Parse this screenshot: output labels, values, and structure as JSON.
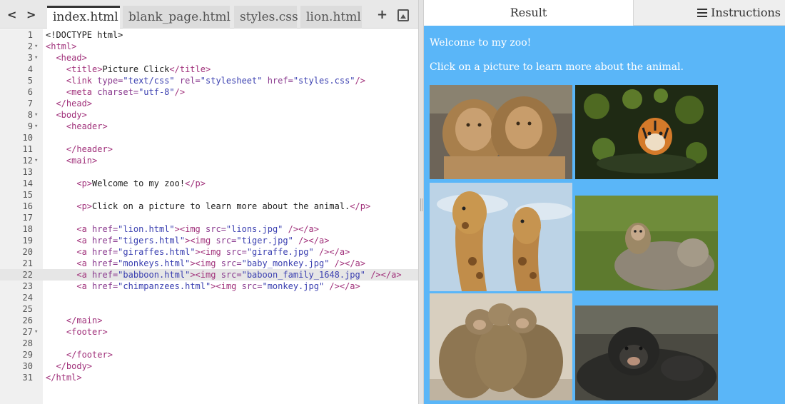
{
  "editor": {
    "tabs": [
      "index.html",
      "blank_page.html",
      "styles.css",
      "lion.html"
    ],
    "active_tab": 0,
    "nav_arrows": "< >",
    "add_tab_icon": "plus-icon",
    "image_tab_icon": "image-icon",
    "highlighted_line": 22,
    "lines": [
      {
        "n": "1",
        "fold": "",
        "tokens": [
          [
            "t",
            "<!DOCTYPE html>"
          ]
        ]
      },
      {
        "n": "2",
        "fold": "▾",
        "tokens": [
          [
            "g",
            "<html>"
          ]
        ]
      },
      {
        "n": "3",
        "fold": "▾",
        "tokens": [
          [
            "t",
            "  "
          ],
          [
            "g",
            "<head>"
          ]
        ]
      },
      {
        "n": "4",
        "fold": "",
        "tokens": [
          [
            "t",
            "    "
          ],
          [
            "g",
            "<title>"
          ],
          [
            "t",
            "Picture Click"
          ],
          [
            "g",
            "</title>"
          ]
        ]
      },
      {
        "n": "5",
        "fold": "",
        "tokens": [
          [
            "t",
            "    "
          ],
          [
            "g",
            "<link "
          ],
          [
            "a",
            "type="
          ],
          [
            "v",
            "\"text/css\""
          ],
          [
            "a",
            " rel="
          ],
          [
            "v",
            "\"stylesheet\""
          ],
          [
            "a",
            " href="
          ],
          [
            "v",
            "\"styles.css\""
          ],
          [
            "g",
            "/>"
          ]
        ]
      },
      {
        "n": "6",
        "fold": "",
        "tokens": [
          [
            "t",
            "    "
          ],
          [
            "g",
            "<meta "
          ],
          [
            "a",
            "charset="
          ],
          [
            "v",
            "\"utf-8\""
          ],
          [
            "g",
            "/>"
          ]
        ]
      },
      {
        "n": "7",
        "fold": "",
        "tokens": [
          [
            "t",
            "  "
          ],
          [
            "g",
            "</head>"
          ]
        ]
      },
      {
        "n": "8",
        "fold": "▾",
        "tokens": [
          [
            "t",
            "  "
          ],
          [
            "g",
            "<body>"
          ]
        ]
      },
      {
        "n": "9",
        "fold": "▾",
        "tokens": [
          [
            "t",
            "    "
          ],
          [
            "g",
            "<header>"
          ]
        ]
      },
      {
        "n": "10",
        "fold": "",
        "tokens": []
      },
      {
        "n": "11",
        "fold": "",
        "tokens": [
          [
            "t",
            "    "
          ],
          [
            "g",
            "</header>"
          ]
        ]
      },
      {
        "n": "12",
        "fold": "▾",
        "tokens": [
          [
            "t",
            "    "
          ],
          [
            "g",
            "<main>"
          ]
        ]
      },
      {
        "n": "13",
        "fold": "",
        "tokens": []
      },
      {
        "n": "14",
        "fold": "",
        "tokens": [
          [
            "t",
            "      "
          ],
          [
            "g",
            "<p>"
          ],
          [
            "t",
            "Welcome to my zoo!"
          ],
          [
            "g",
            "</p>"
          ]
        ]
      },
      {
        "n": "15",
        "fold": "",
        "tokens": []
      },
      {
        "n": "16",
        "fold": "",
        "tokens": [
          [
            "t",
            "      "
          ],
          [
            "g",
            "<p>"
          ],
          [
            "t",
            "Click on a picture to learn more about the animal."
          ],
          [
            "g",
            "</p>"
          ]
        ]
      },
      {
        "n": "17",
        "fold": "",
        "tokens": []
      },
      {
        "n": "18",
        "fold": "",
        "tokens": [
          [
            "t",
            "      "
          ],
          [
            "g",
            "<a "
          ],
          [
            "a",
            "href="
          ],
          [
            "v",
            "\"lion.html\""
          ],
          [
            "g",
            "><img "
          ],
          [
            "a",
            "src="
          ],
          [
            "v",
            "\"lions.jpg\""
          ],
          [
            "g",
            " /></a>"
          ]
        ]
      },
      {
        "n": "19",
        "fold": "",
        "tokens": [
          [
            "t",
            "      "
          ],
          [
            "g",
            "<a "
          ],
          [
            "a",
            "href="
          ],
          [
            "v",
            "\"tigers.html\""
          ],
          [
            "g",
            "><img "
          ],
          [
            "a",
            "src="
          ],
          [
            "v",
            "\"tiger.jpg\""
          ],
          [
            "g",
            " /></a>"
          ]
        ]
      },
      {
        "n": "20",
        "fold": "",
        "tokens": [
          [
            "t",
            "      "
          ],
          [
            "g",
            "<a "
          ],
          [
            "a",
            "href="
          ],
          [
            "v",
            "\"giraffes.html\""
          ],
          [
            "g",
            "><img "
          ],
          [
            "a",
            "src="
          ],
          [
            "v",
            "\"giraffe.jpg\""
          ],
          [
            "g",
            " /></a>"
          ]
        ]
      },
      {
        "n": "21",
        "fold": "",
        "tokens": [
          [
            "t",
            "      "
          ],
          [
            "g",
            "<a "
          ],
          [
            "a",
            "href="
          ],
          [
            "v",
            "\"monkeys.html\""
          ],
          [
            "g",
            "><img "
          ],
          [
            "a",
            "src="
          ],
          [
            "v",
            "\"baby_monkey.jpg\""
          ],
          [
            "g",
            " /></a>"
          ]
        ]
      },
      {
        "n": "22",
        "fold": "",
        "tokens": [
          [
            "t",
            "      "
          ],
          [
            "g",
            "<a "
          ],
          [
            "a",
            "href="
          ],
          [
            "v",
            "\"babboon.html\""
          ],
          [
            "g",
            "><img "
          ],
          [
            "a",
            "src="
          ],
          [
            "v",
            "\"baboon_family_1648.jpg\""
          ],
          [
            "g",
            " /></a>"
          ]
        ]
      },
      {
        "n": "23",
        "fold": "",
        "tokens": [
          [
            "t",
            "      "
          ],
          [
            "g",
            "<a "
          ],
          [
            "a",
            "href="
          ],
          [
            "v",
            "\"chimpanzees.html\""
          ],
          [
            "g",
            "><img "
          ],
          [
            "a",
            "src="
          ],
          [
            "v",
            "\"monkey.jpg\""
          ],
          [
            "g",
            " /></a>"
          ]
        ]
      },
      {
        "n": "24",
        "fold": "",
        "tokens": []
      },
      {
        "n": "25",
        "fold": "",
        "tokens": []
      },
      {
        "n": "26",
        "fold": "",
        "tokens": [
          [
            "t",
            "    "
          ],
          [
            "g",
            "</main>"
          ]
        ]
      },
      {
        "n": "27",
        "fold": "▾",
        "tokens": [
          [
            "t",
            "    "
          ],
          [
            "g",
            "<footer>"
          ]
        ]
      },
      {
        "n": "28",
        "fold": "",
        "tokens": []
      },
      {
        "n": "29",
        "fold": "",
        "tokens": [
          [
            "t",
            "    "
          ],
          [
            "g",
            "</footer>"
          ]
        ]
      },
      {
        "n": "30",
        "fold": "",
        "tokens": [
          [
            "t",
            "  "
          ],
          [
            "g",
            "</body>"
          ]
        ]
      },
      {
        "n": "31",
        "fold": "",
        "tokens": [
          [
            "g",
            "</html>"
          ]
        ]
      }
    ]
  },
  "result": {
    "tab_result": "Result",
    "tab_instructions": "Instructions",
    "instructions_icon": "list-icon",
    "welcome": "Welcome to my zoo!",
    "instruction": "Click on a picture to learn more about the animal.",
    "background_color": "#5ab6f8",
    "photos": [
      "lions",
      "tiger",
      "giraffes",
      "baby-monkey",
      "baboon-family",
      "chimpanzee"
    ]
  }
}
